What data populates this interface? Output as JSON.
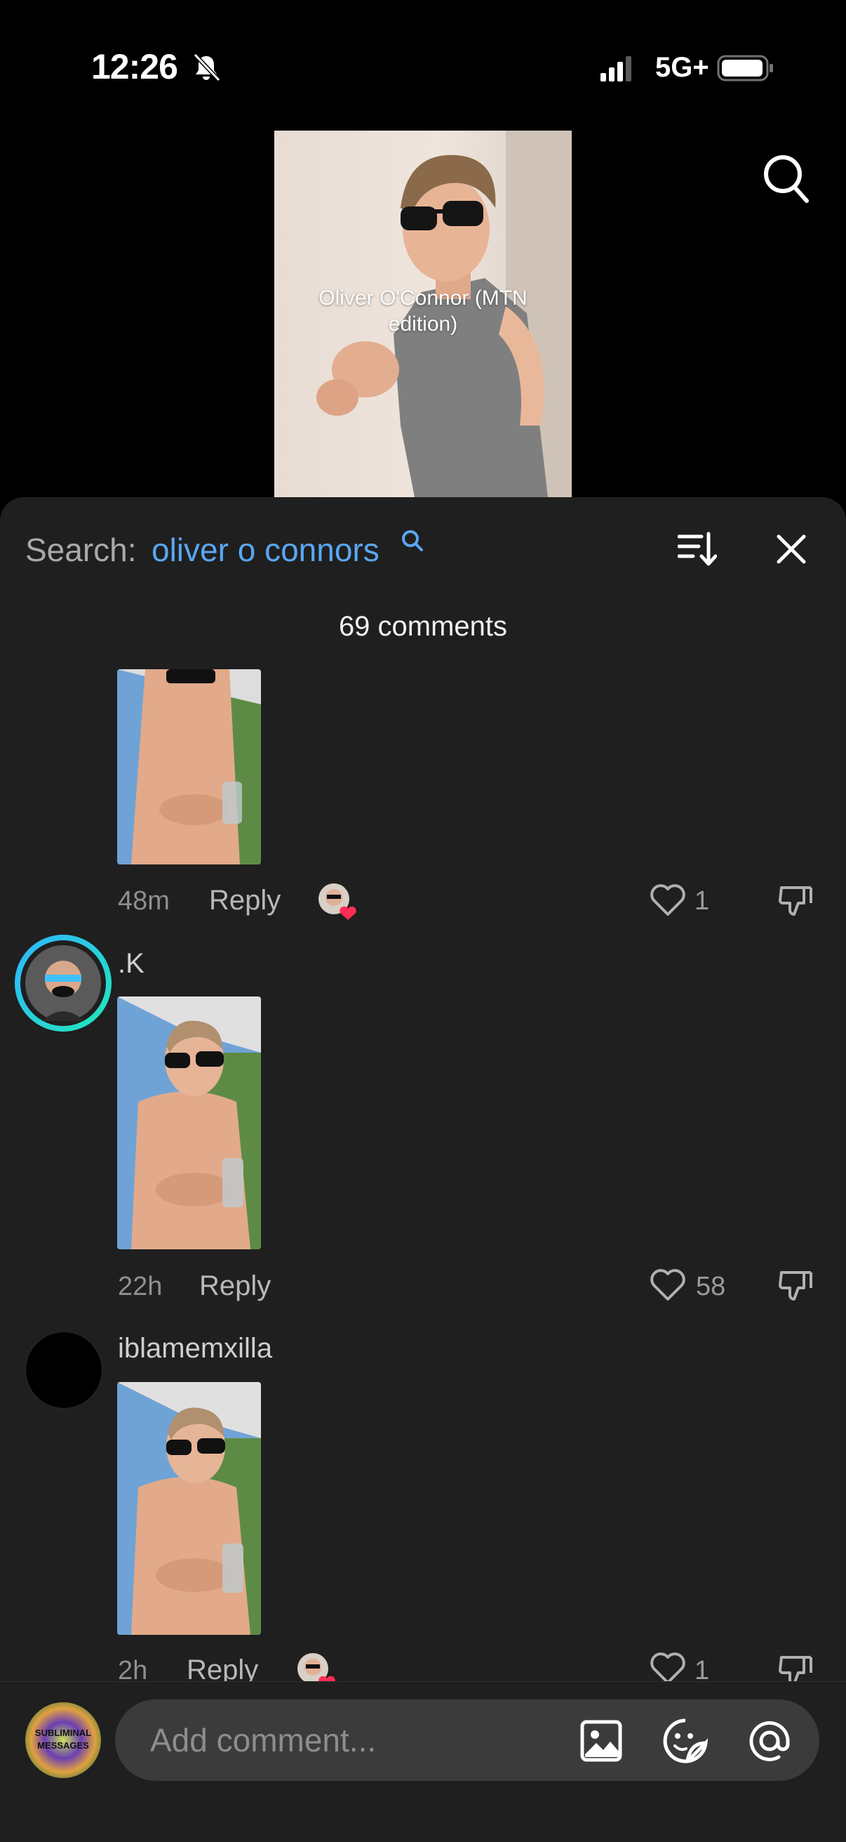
{
  "status_bar": {
    "time": "12:26",
    "network": "5G+"
  },
  "video": {
    "caption": "Oliver O'Connor (MTN edition)"
  },
  "sheet": {
    "search_prefix": "Search:",
    "search_query": "oliver o connors",
    "comment_count": "69 comments"
  },
  "comments": [
    {
      "username": "",
      "time": "48m",
      "reply": "Reply",
      "likes": "1"
    },
    {
      "username": ".K",
      "time": "22h",
      "reply": "Reply",
      "likes": "58"
    },
    {
      "username": "iblamemxilla",
      "time": "2h",
      "reply": "Reply",
      "likes": "1"
    }
  ],
  "composer": {
    "placeholder": "Add comment...",
    "avatar_text": "SUBLIMINAL MESSAGES"
  },
  "colors": {
    "accent": "#5aa7f2",
    "sheet_bg": "#1f1f1f",
    "heart": "#ff2d55"
  }
}
